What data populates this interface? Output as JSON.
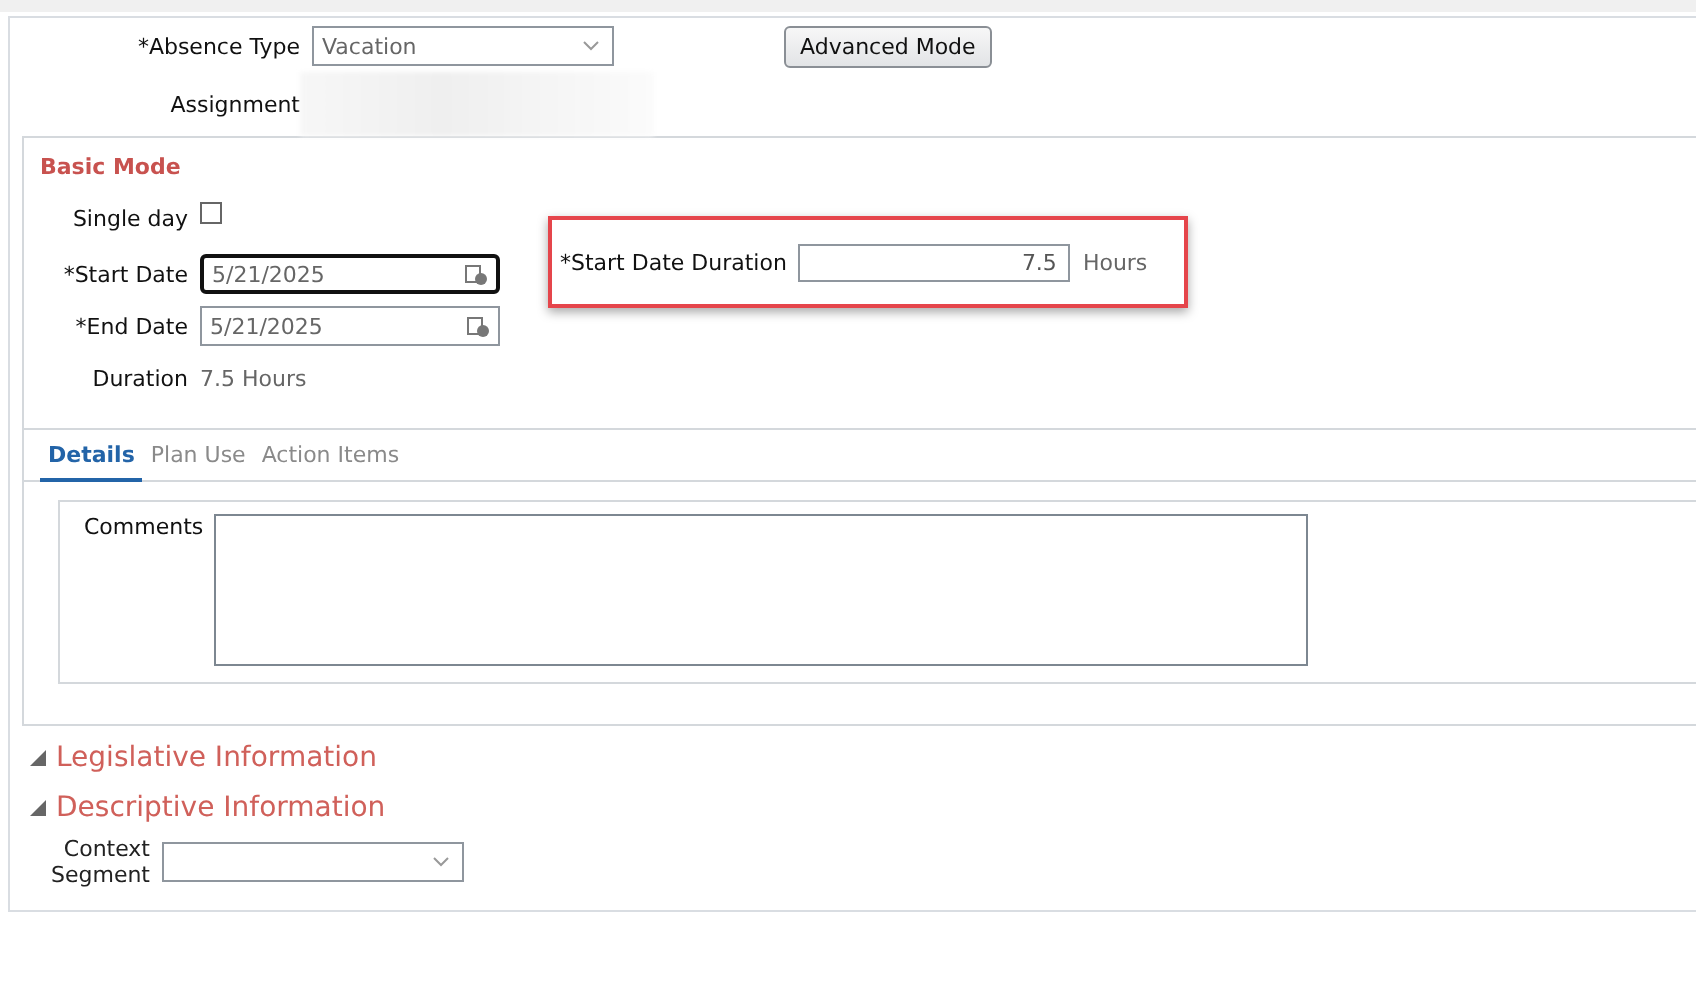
{
  "absence_type": {
    "label": "*Absence Type",
    "value": "Vacation"
  },
  "advanced_button": "Advanced Mode",
  "assignment": {
    "label": "Assignment"
  },
  "basic_mode": {
    "title": "Basic Mode",
    "single_day": {
      "label": "Single day",
      "checked": false
    },
    "start_date": {
      "label": "*Start Date",
      "value": "5/21/2025",
      "focused": true
    },
    "end_date": {
      "label": "*End Date",
      "value": "5/21/2025",
      "focused": false
    },
    "duration": {
      "label": "Duration",
      "value": "7.5 Hours"
    },
    "start_date_duration": {
      "label": "*Start Date Duration",
      "value": "7.5",
      "unit": "Hours"
    }
  },
  "tabs": [
    {
      "label": "Details",
      "selected": true
    },
    {
      "label": "Plan Use",
      "selected": false
    },
    {
      "label": "Action Items",
      "selected": false
    }
  ],
  "comments": {
    "label": "Comments"
  },
  "sections": [
    "Legislative Information",
    "Descriptive Information"
  ],
  "context_segment": {
    "label_lines": [
      "Context",
      "Segment"
    ]
  }
}
